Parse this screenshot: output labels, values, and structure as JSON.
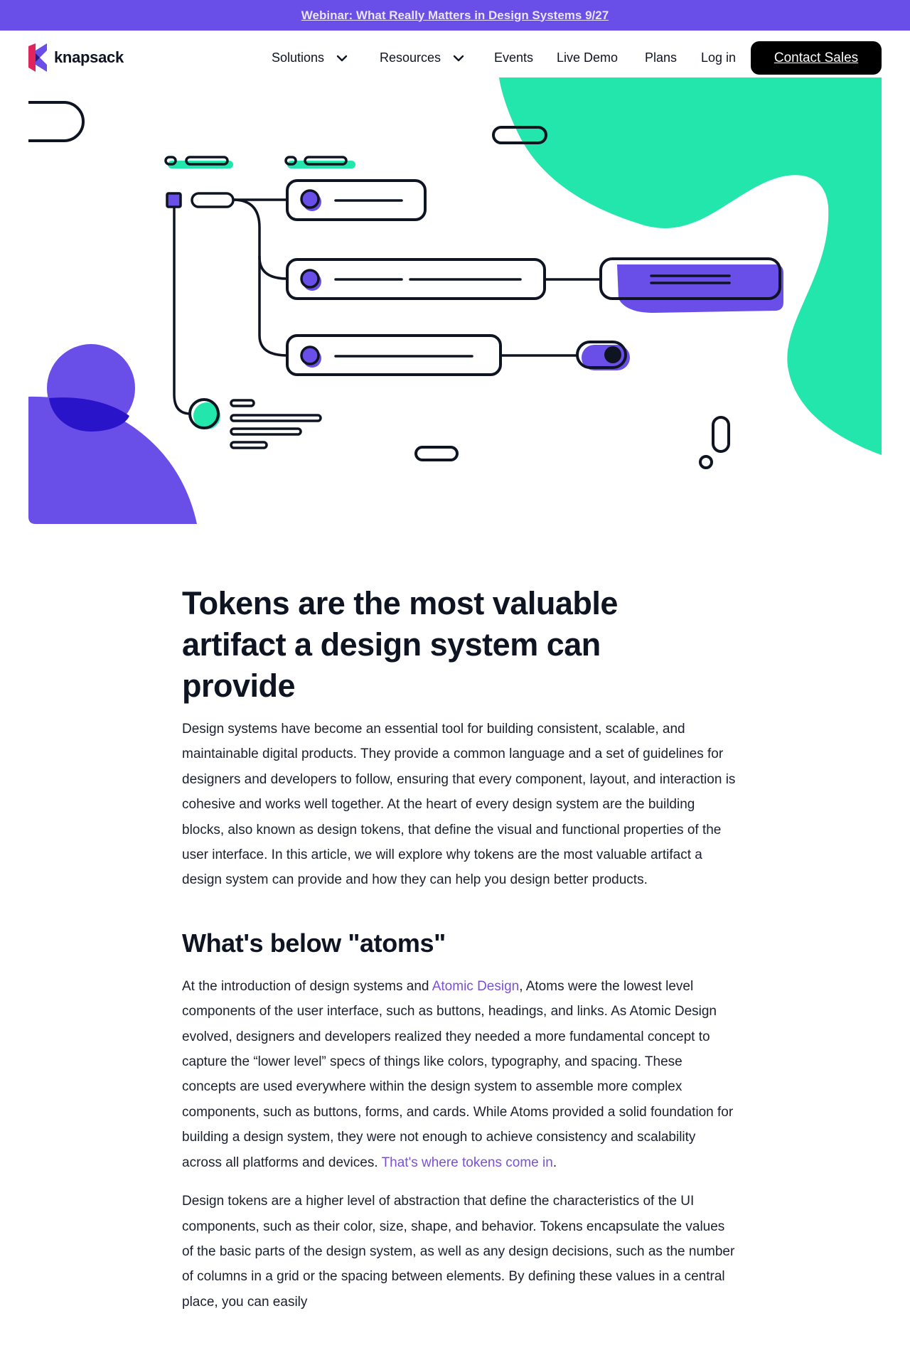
{
  "banner": {
    "text": "Webinar: What Really Matters in Design Systems 9/27"
  },
  "header": {
    "logo_text": "knapsack",
    "nav": [
      {
        "label": "Solutions",
        "dropdown": true
      },
      {
        "label": "Resources",
        "dropdown": true
      },
      {
        "label": "Events",
        "dropdown": false
      },
      {
        "label": "Live Demo",
        "dropdown": false
      },
      {
        "label": "Plans",
        "dropdown": false
      },
      {
        "label": "Log in",
        "dropdown": false
      }
    ],
    "cta_label": "Contact Sales"
  },
  "colors": {
    "brand_purple": "#6a4ee8",
    "accent_green": "#22e6ac",
    "text_dark": "#0f1422",
    "link_purple": "#7b4fd8",
    "cta_black": "#000000"
  },
  "article": {
    "title": "Tokens are the most valuable artifact a design system can provide",
    "intro": "Design systems have become an essential tool for building consistent, scalable, and maintainable digital products. They provide a common language and a set of guidelines for designers and developers to follow, ensuring that every component, layout, and interaction is cohesive and works well together. At the heart of every design system are the building blocks, also known as design tokens, that define the visual and functional properties of the user interface. In this article, we will explore why tokens are the most valuable artifact a design system can provide and how they can help you design better products.",
    "section_heading": "What's below \"atoms\"",
    "p1_before": "At the introduction of design systems and ",
    "p1_link": "Atomic Design",
    "p1_after": ", Atoms were the lowest level components of the user interface, such as buttons, headings, and links. As Atomic Design evolved, designers and developers realized they needed a more fundamental concept to capture the “lower level” specs of things like colors, typography, and spacing. These concepts are used everywhere within the design system to assemble more complex components, such as buttons, forms, and cards. While Atoms provided a solid foundation for building a design system, they were not enough to achieve consistency and scalability across all platforms and devices. ",
    "p1_link2": "That's where tokens come in",
    "p1_end": ".",
    "p2": "Design tokens are a higher level of abstraction that define the characteristics of the UI components, such as their color, size, shape, and behavior. Tokens encapsulate the values of the basic parts of the design system, as well as any design decisions, such as the number of columns in a grid or the spacing between elements. By defining these values in a central place, you can easily"
  }
}
